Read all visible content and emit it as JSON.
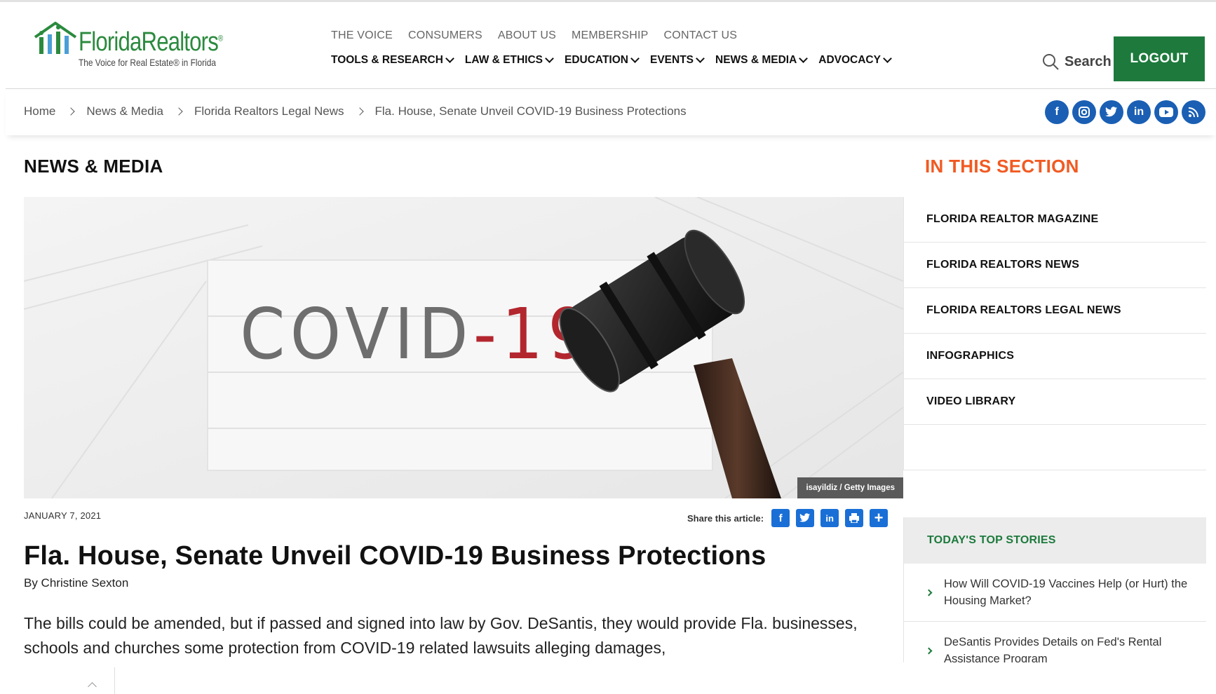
{
  "brand": {
    "name": "FloridaRealtors",
    "tagline": "The Voice for Real Estate® in Florida",
    "green": "#2b8a3e",
    "accent_orange": "#f15a22",
    "link_blue": "#1a6fd6"
  },
  "topnav": [
    "THE VOICE",
    "CONSUMERS",
    "ABOUT US",
    "MEMBERSHIP",
    "CONTACT US"
  ],
  "mainnav": [
    "TOOLS & RESEARCH",
    "LAW & ETHICS",
    "EDUCATION",
    "EVENTS",
    "NEWS & MEDIA",
    "ADVOCACY"
  ],
  "search": {
    "label": "Search"
  },
  "logout": {
    "label": "LOGOUT"
  },
  "breadcrumb": [
    "Home",
    "News & Media",
    "Florida Realtors Legal News",
    "Fla. House, Senate Unveil COVID-19 Business Protections"
  ],
  "social": [
    "facebook-icon",
    "instagram-icon",
    "twitter-icon",
    "linkedin-icon",
    "youtube-icon",
    "rss-icon"
  ],
  "article": {
    "section": "NEWS & MEDIA",
    "image_text": "COVID-19",
    "image_credit": "isayildiz / Getty Images",
    "date": "JANUARY 7, 2021",
    "share_label": "Share this article:",
    "title": "Fla. House, Senate Unveil COVID-19 Business Protections",
    "byline": "By Christine Sexton",
    "lede": "The bills could be amended, but if passed and signed into law by Gov. DeSantis, they would provide Fla. businesses, schools and churches some protection from COVID-19 related lawsuits alleging damages,"
  },
  "sidebar": {
    "title": "IN THIS SECTION",
    "items": [
      "FLORIDA REALTOR MAGAZINE",
      "FLORIDA REALTORS NEWS",
      "FLORIDA REALTORS LEGAL NEWS",
      "INFOGRAPHICS",
      "VIDEO LIBRARY"
    ],
    "top_stories_title": "TODAY'S TOP STORIES",
    "top_stories": [
      "How Will COVID-19 Vaccines Help (or Hurt) the Housing Market?",
      "DeSantis Provides Details on Fed's Rental Assistance Program"
    ]
  }
}
